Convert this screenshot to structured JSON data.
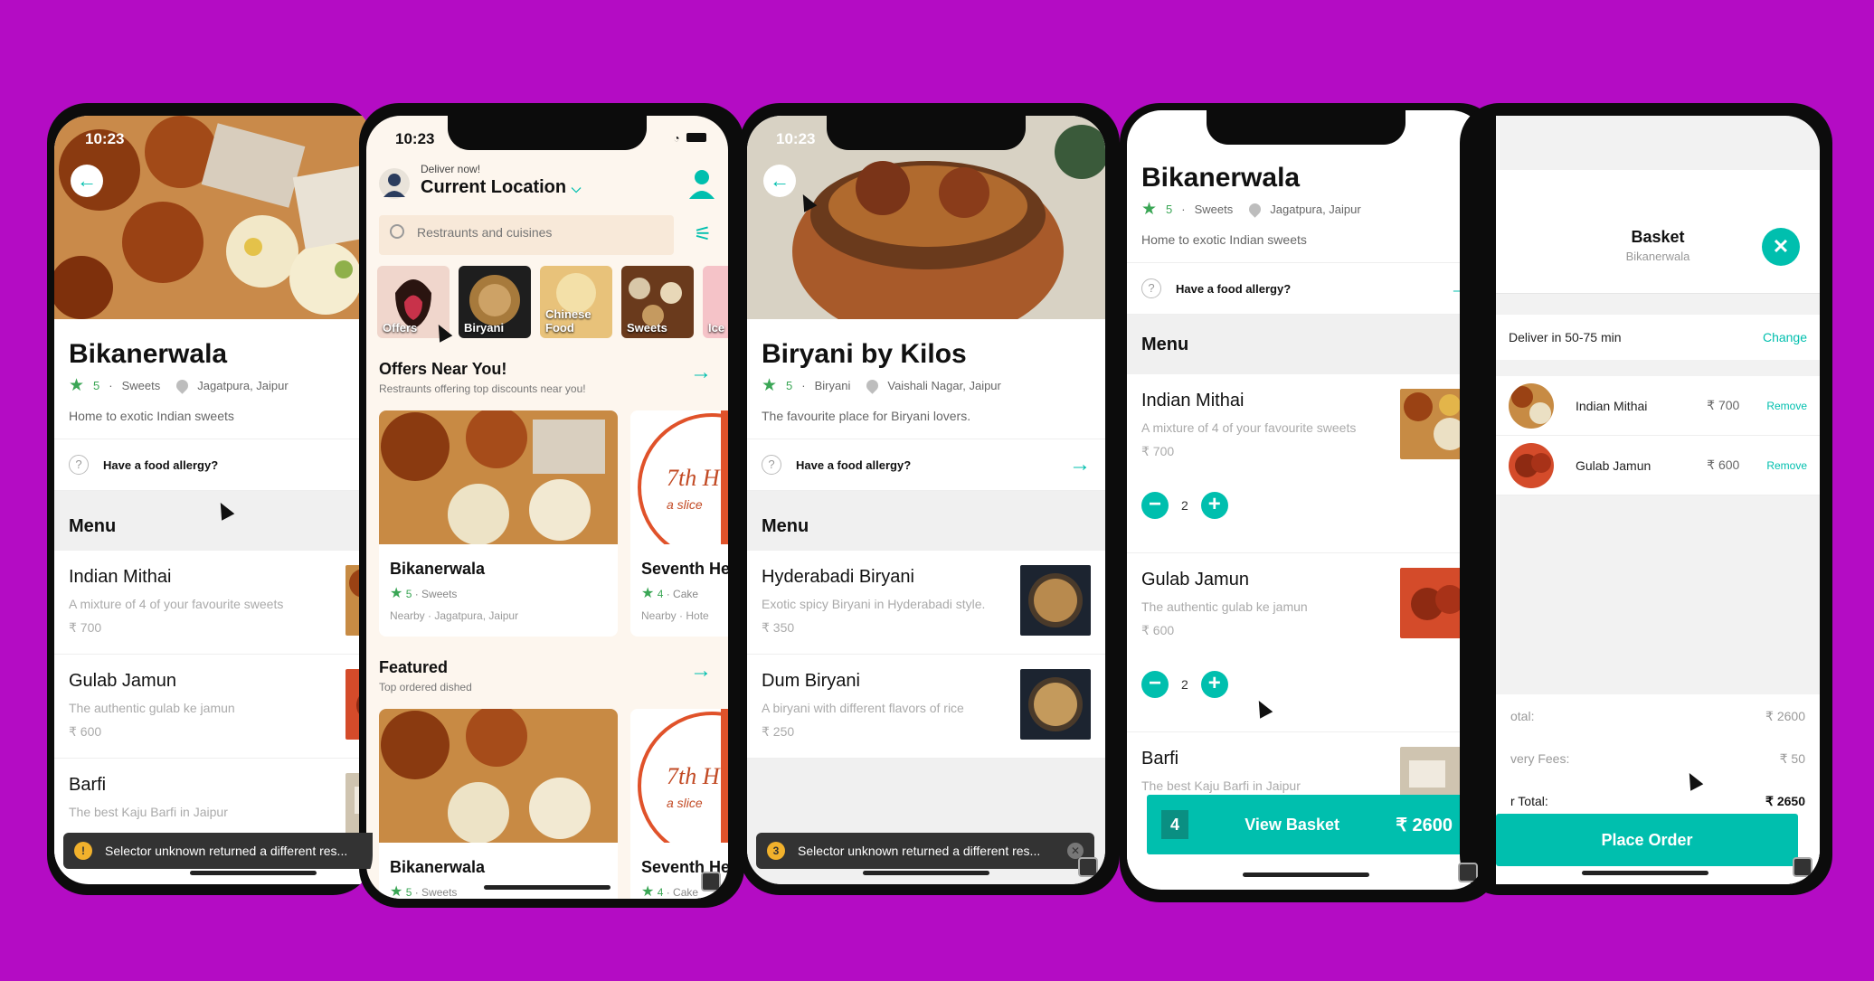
{
  "colors": {
    "background": "#b40cc4",
    "accent": "#00bfae",
    "star": "#3aa655"
  },
  "p1": {
    "time": "10:23",
    "name": "Bikanerwala",
    "rating": "5",
    "category": "Sweets",
    "location": "Jagatpura, Jaipur",
    "description": "Home to exotic Indian sweets",
    "allergy": "Have a food allergy?",
    "menu_title": "Menu",
    "items": [
      {
        "name": "Indian Mithai",
        "desc": "A mixture of 4 of your favourite sweets",
        "price": "₹ 700"
      },
      {
        "name": "Gulab Jamun",
        "desc": "The authentic gulab ke jamun",
        "price": "₹ 600"
      },
      {
        "name": "Barfi",
        "desc": "The best Kaju Barfi in Jaipur"
      }
    ],
    "toast": "Selector unknown returned a different res..."
  },
  "p2": {
    "time": "10:23",
    "deliver_label": "Deliver now!",
    "location_title": "Current Location",
    "search_placeholder": "Restraunts and cuisines",
    "categories": [
      {
        "label": "Offers"
      },
      {
        "label": "Biryani"
      },
      {
        "label": "Chinese Food"
      },
      {
        "label": "Sweets"
      },
      {
        "label": "Ice"
      }
    ],
    "offers_title": "Offers Near You!",
    "offers_sub": "Restraunts offering top discounts near you!",
    "cards": [
      {
        "name": "Bikanerwala",
        "rating": "5",
        "category": "Sweets",
        "loc": "Nearby · Jagatpura, Jaipur"
      },
      {
        "name": "Seventh He",
        "rating": "4",
        "category": "Cake",
        "loc": "Nearby · Hote"
      }
    ],
    "featured_title": "Featured",
    "featured_sub": "Top ordered dished",
    "feat_cards": [
      {
        "name": "Bikanerwala",
        "rating": "5",
        "category": "Sweets"
      },
      {
        "name": "Seventh He",
        "rating": "4",
        "category": "Cake"
      }
    ],
    "logo_text": "7th H",
    "logo_sub": "a slice"
  },
  "p3": {
    "time": "10:23",
    "name": "Biryani by Kilos",
    "rating": "5",
    "category": "Biryani",
    "location": "Vaishali Nagar, Jaipur",
    "description": "The favourite place for Biryani lovers.",
    "allergy": "Have a food allergy?",
    "menu_title": "Menu",
    "items": [
      {
        "name": "Hyderabadi Biryani",
        "desc": "Exotic spicy Biryani in Hyderabadi style.",
        "price": "₹ 350"
      },
      {
        "name": "Dum Biryani",
        "desc": "A biryani with different flavors of rice",
        "price": "₹ 250"
      }
    ],
    "toast": "Selector unknown returned a different res...",
    "toast_num": "3"
  },
  "p4": {
    "name": "Bikanerwala",
    "rating": "5",
    "category": "Sweets",
    "location": "Jagatpura, Jaipur",
    "description": "Home to exotic Indian sweets",
    "allergy": "Have a food allergy?",
    "menu_title": "Menu",
    "items": [
      {
        "name": "Indian Mithai",
        "desc": "A mixture of 4 of your favourite sweets",
        "price": "₹ 700",
        "qty": "2"
      },
      {
        "name": "Gulab Jamun",
        "desc": "The authentic gulab ke jamun",
        "price": "₹ 600",
        "qty": "2"
      },
      {
        "name": "Barfi",
        "desc": "The best Kaju Barfi in Jaipur"
      }
    ],
    "basket_count": "4",
    "basket_label": "View Basket",
    "basket_total": "₹ 2600"
  },
  "p5": {
    "title": "Basket",
    "subtitle": "Bikanerwala",
    "deliver": "Deliver in 50-75 min",
    "change": "Change",
    "items": [
      {
        "name": "Indian Mithai",
        "price": "₹ 700",
        "action": "Remove"
      },
      {
        "name": "Gulab Jamun",
        "price": "₹ 600",
        "action": "Remove"
      }
    ],
    "subtotal_label": "otal:",
    "subtotal": "₹ 2600",
    "fees_label": "very Fees:",
    "fees": "₹ 50",
    "order_total_label": "r Total:",
    "order_total": "₹ 2650",
    "place_order": "Place Order"
  }
}
